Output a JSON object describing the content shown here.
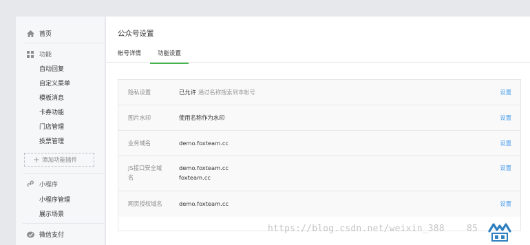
{
  "sidebar": {
    "home_label": "首页",
    "function_group_label": "功能",
    "function_items": [
      "自动回复",
      "自定义菜单",
      "模板消息",
      "卡券功能",
      "门店管理",
      "投票管理"
    ],
    "add_plugin_label": "添加功能插件",
    "miniprogram_group_label": "小程序",
    "miniprogram_items": [
      "小程序管理",
      "展示场景"
    ],
    "wechat_pay_label": "微信支付"
  },
  "main": {
    "page_title": "公众号设置",
    "tabs": [
      {
        "label": "帐号详情",
        "active": false
      },
      {
        "label": "功能设置",
        "active": true
      }
    ],
    "rows": [
      {
        "label": "隐私设置",
        "value": "已允许",
        "hint": "通过名称搜索到本帐号",
        "action": "设置"
      },
      {
        "label": "图片水印",
        "value": "使用名称作为水印",
        "action": "设置"
      },
      {
        "label": "业务域名",
        "value": "demo.foxteam.cc",
        "action": "设置"
      },
      {
        "label": "JS接口安全域名",
        "label_lines": [
          "JS接口安全域",
          "名"
        ],
        "value_lines": [
          "demo.foxteam.cc",
          "foxteam.cc"
        ],
        "action": "设置"
      },
      {
        "label": "网页授权域名",
        "value": "demo.foxteam.cc",
        "action": "设置"
      }
    ]
  },
  "watermark": {
    "text": "https://blog.csdn.net/weixin_388",
    "suffix": "85"
  },
  "colors": {
    "accent_green": "#44b549",
    "link_blue": "#459ae9"
  },
  "icons": [
    "home-icon",
    "grid-icon",
    "miniprogram-icon",
    "wechat-pay-icon"
  ]
}
